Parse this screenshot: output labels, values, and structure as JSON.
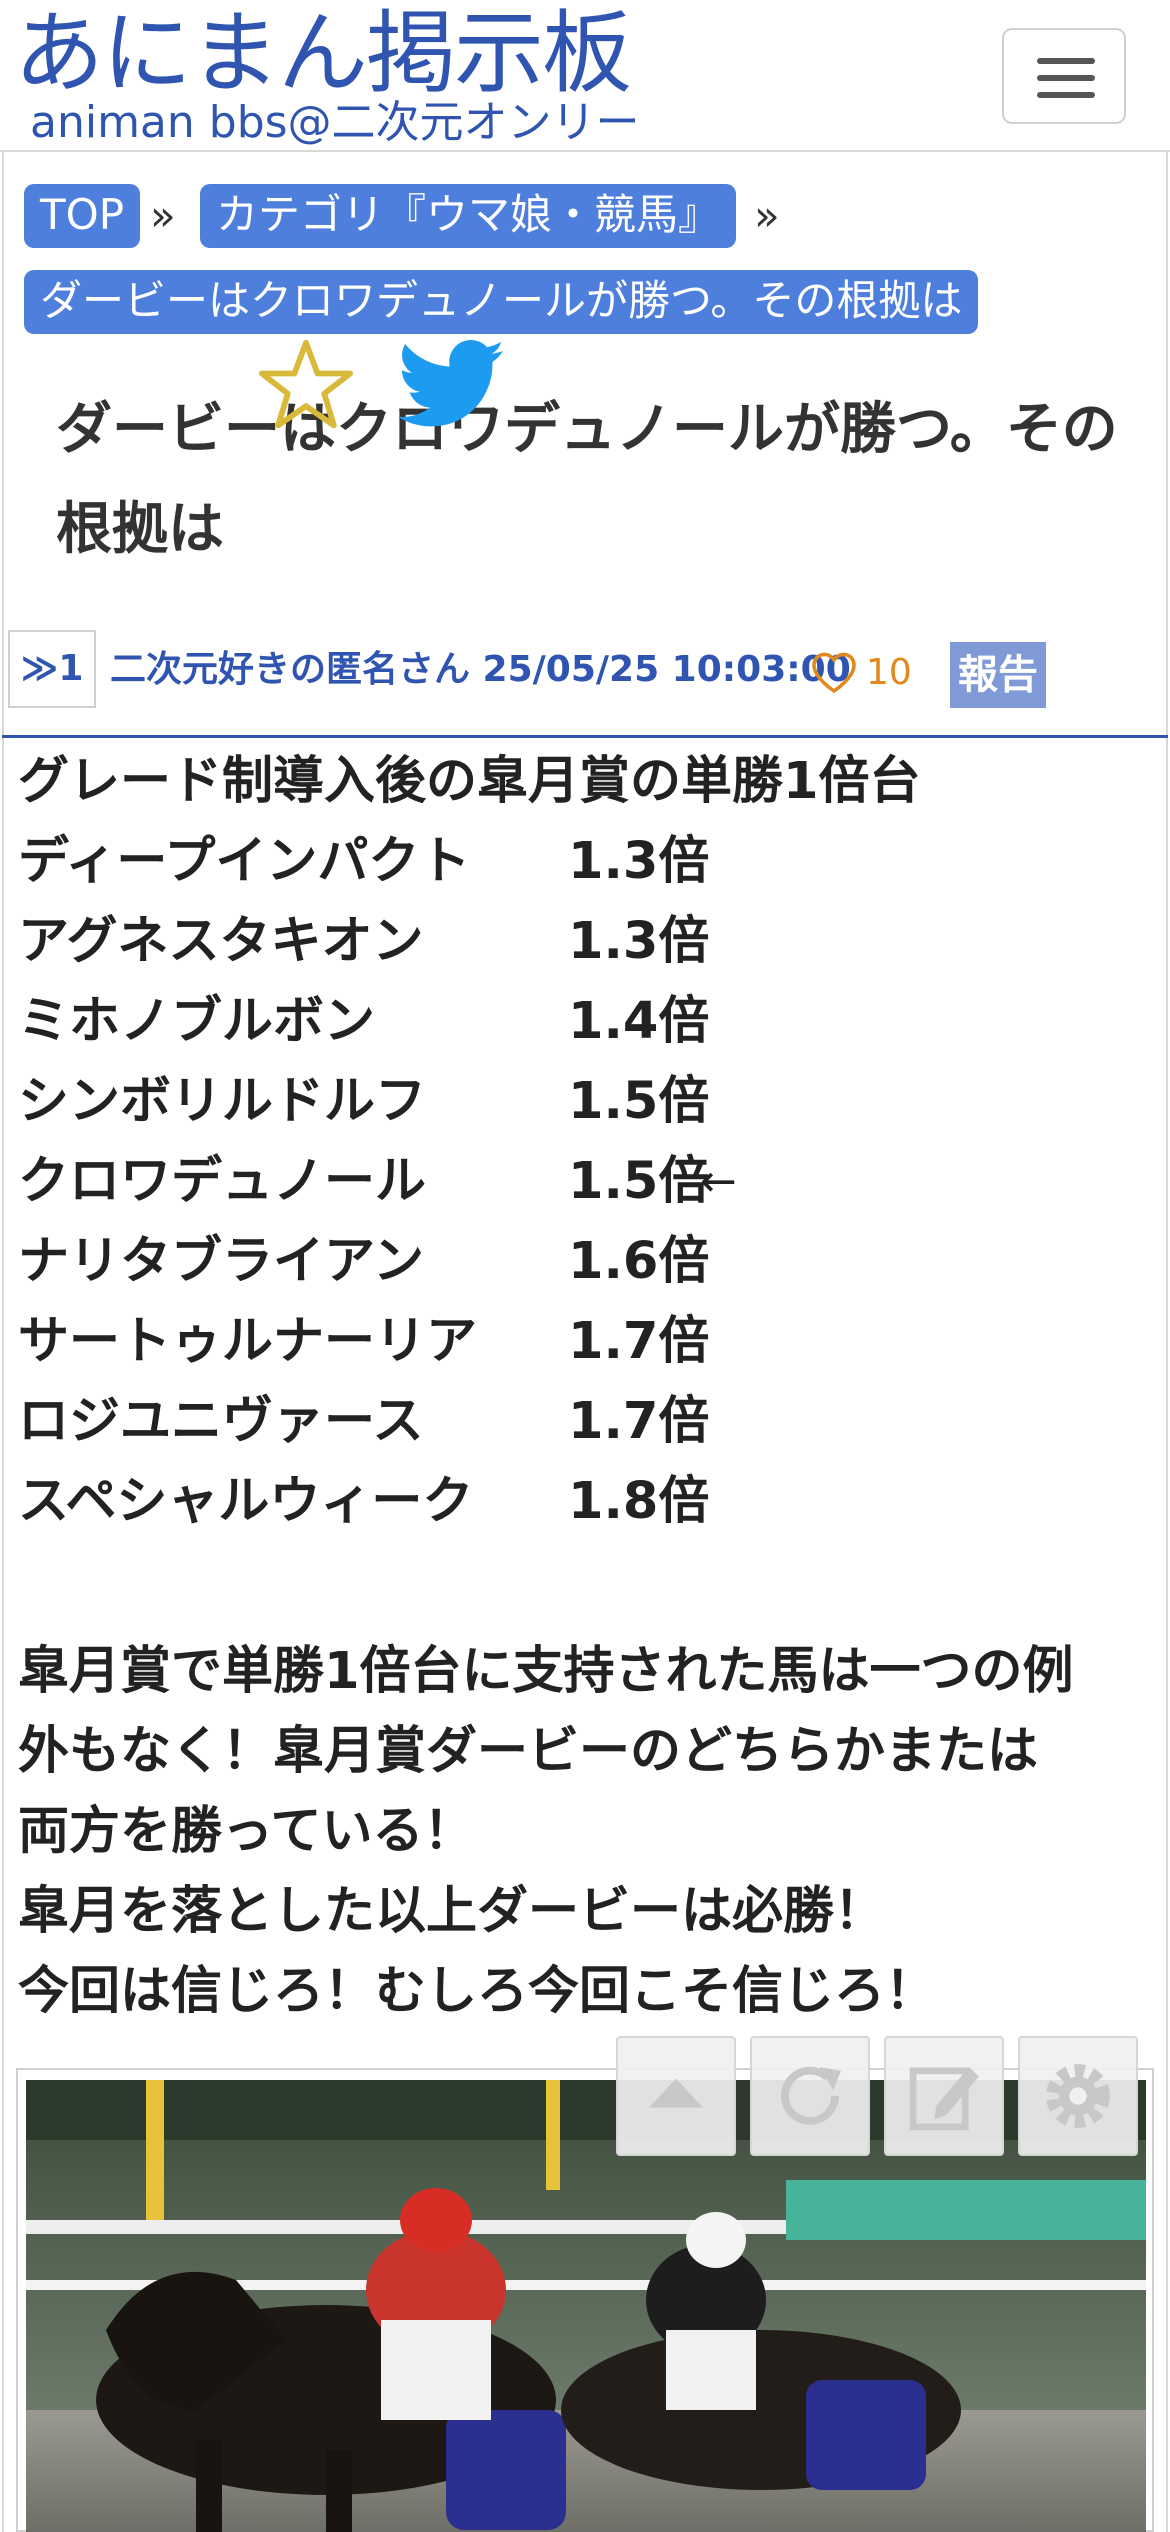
{
  "header": {
    "logo_main": "あにまん掲示板",
    "logo_sub": "animan bbs@二次元オンリー",
    "menu_icon": "hamburger-menu-icon"
  },
  "breadcrumb": {
    "items": [
      "TOP",
      "カテゴリ『ウマ娘・競馬』",
      "ダービーはクロワデュノールが勝つ。その根拠は"
    ],
    "separator": "»"
  },
  "thread": {
    "title_line1": "ダービーはクロワデュノールが勝つ。その",
    "title_line2": "根拠は",
    "favorite_icon": "star-outline-icon",
    "share_icon": "twitter-bird-icon"
  },
  "post": {
    "number": "1",
    "author_date": "二次元好きの匿名さん 25/05/25 10:03:00",
    "likes": "10",
    "report_label": "報告",
    "heading": "グレード制導入後の皐月賞の単勝1倍台",
    "odds": [
      {
        "name": "ディープインパクト",
        "odds": "1.3倍",
        "mark": ""
      },
      {
        "name": "アグネスタキオン",
        "odds": "1.3倍",
        "mark": ""
      },
      {
        "name": "ミホノブルボン",
        "odds": "1.4倍",
        "mark": ""
      },
      {
        "name": "シンボリルドルフ",
        "odds": "1.5倍",
        "mark": ""
      },
      {
        "name": "クロワデュノール",
        "odds": "1.5倍",
        "mark": "←"
      },
      {
        "name": "ナリタブライアン",
        "odds": "1.6倍",
        "mark": ""
      },
      {
        "name": "サートゥルナーリア",
        "odds": "1.7倍",
        "mark": ""
      },
      {
        "name": "ロジユニヴァース",
        "odds": "1.7倍",
        "mark": ""
      },
      {
        "name": "スペシャルウィーク",
        "odds": "1.8倍",
        "mark": ""
      }
    ],
    "text": [
      "皐月賞で単勝1倍台に支持された馬は一つの例",
      "外もなく！皐月賞ダービーのどちらかまたは",
      "両方を勝っている！",
      "皐月を落とした以上ダービーは必勝！",
      "今回は信じろ！むしろ今回こそ信じろ！"
    ]
  },
  "floating_buttons": [
    "scroll-up-icon",
    "reload-icon",
    "compose-icon",
    "settings-gear-icon"
  ],
  "colors": {
    "brand_blue": "#2f55b0",
    "breadcrumb_bg": "#4f7fdc",
    "like_orange": "#e08a1e",
    "report_bg": "#7f9ad6",
    "star_gold": "#d8b93a",
    "twitter_blue": "#1d9bf0"
  }
}
